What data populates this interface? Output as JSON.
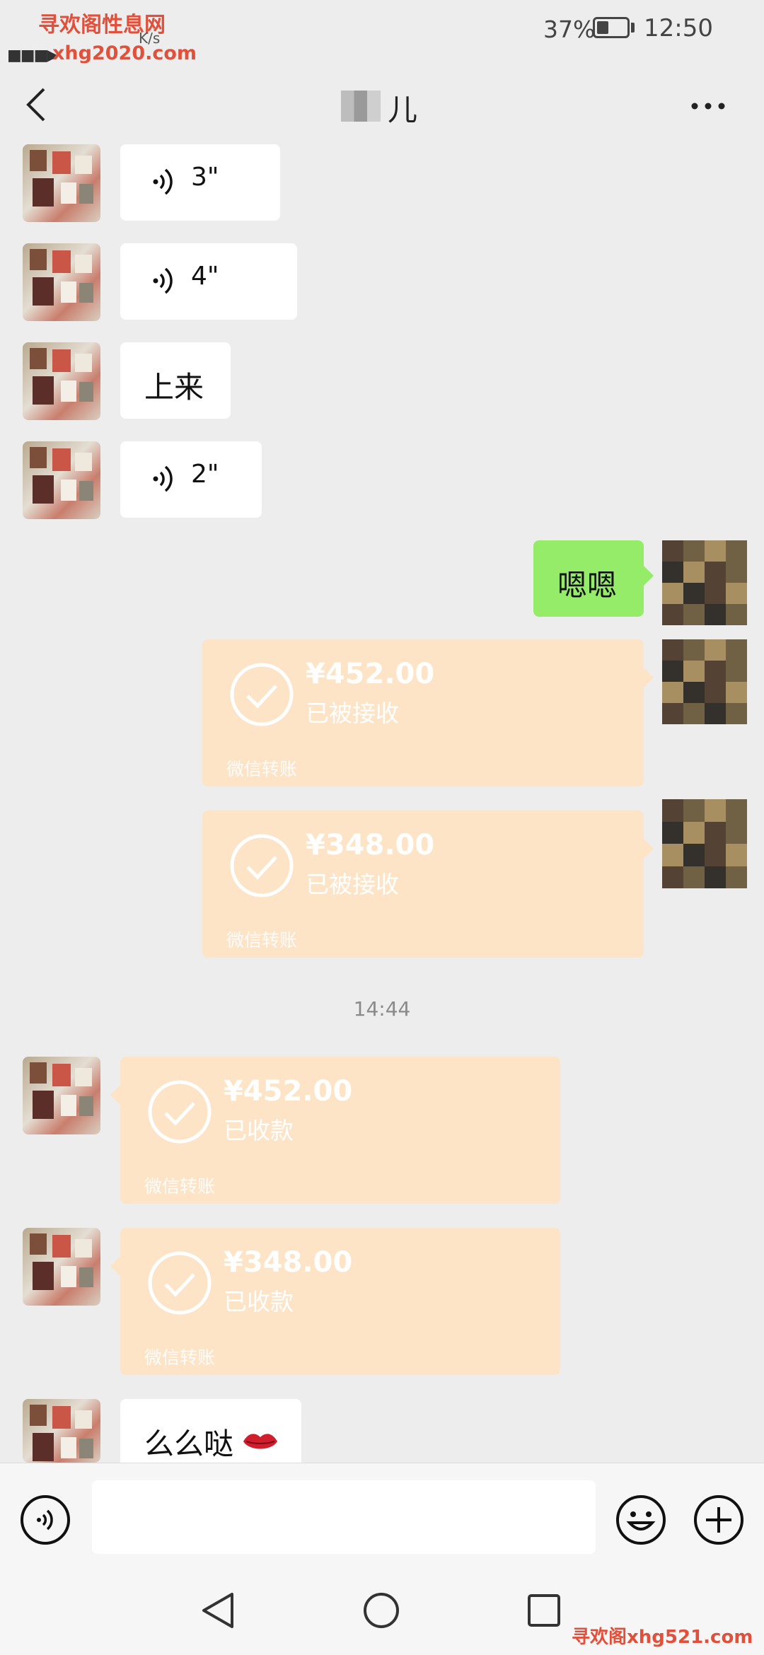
{
  "status_bar": {
    "watermark_top": "寻欢阁性息网",
    "watermark_url": "xhg2020.com",
    "network_speed": "K/s",
    "battery_percent": "37%",
    "battery_level": 0.37,
    "time": "12:50"
  },
  "header": {
    "title": "儿",
    "back_icon": "chevron-left-icon",
    "more_icon": "more-dots-icon"
  },
  "messages": [
    {
      "side": "left",
      "type": "voice",
      "duration": "3\""
    },
    {
      "side": "left",
      "type": "voice",
      "duration": "4\""
    },
    {
      "side": "left",
      "type": "text",
      "text": "上来"
    },
    {
      "side": "left",
      "type": "voice",
      "duration": "2\""
    },
    {
      "side": "right",
      "type": "text",
      "text": "嗯嗯"
    },
    {
      "side": "right",
      "type": "transfer",
      "amount": "¥452.00",
      "status": "已被接收",
      "label": "微信转账"
    },
    {
      "side": "right",
      "type": "transfer",
      "amount": "¥348.00",
      "status": "已被接收",
      "label": "微信转账"
    },
    {
      "type": "time",
      "text": "14:44"
    },
    {
      "side": "left",
      "type": "transfer",
      "amount": "¥452.00",
      "status": "已收款",
      "label": "微信转账"
    },
    {
      "side": "left",
      "type": "transfer",
      "amount": "¥348.00",
      "status": "已收款",
      "label": "微信转账"
    },
    {
      "side": "left",
      "type": "text",
      "text": "么么哒",
      "emoji": "lips-icon"
    }
  ],
  "input_bar": {
    "voice_icon": "voice-mode-icon",
    "emoji_icon": "emoji-icon",
    "plus_icon": "plus-icon",
    "input_value": ""
  },
  "system_nav": {
    "icons": [
      "back-triangle-icon",
      "home-circle-icon",
      "recents-square-icon"
    ],
    "watermark_bottom": "寻欢阁xhg521.com"
  },
  "colors": {
    "background": "#ededed",
    "sent_bubble": "#95ec69",
    "transfer_bubble": "#fde4c7",
    "received_bubble": "#ffffff"
  }
}
